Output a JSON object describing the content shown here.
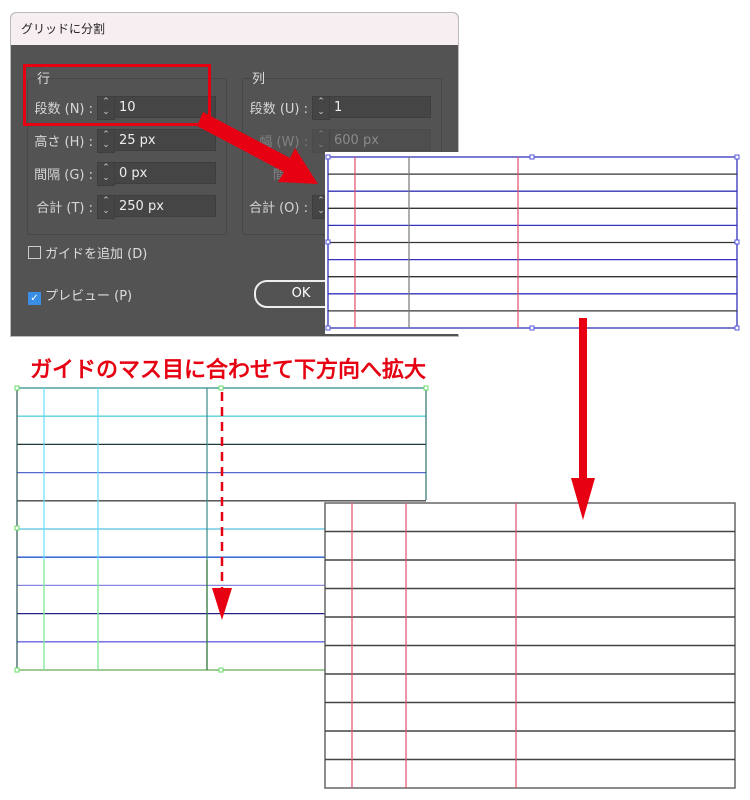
{
  "dialog": {
    "title": "グリッドに分割",
    "rows": {
      "label": "行",
      "fields": [
        {
          "label": "段数 (N) :",
          "value": "10"
        },
        {
          "label": "高さ (H) :",
          "value": "25 px"
        },
        {
          "label": "間隔 (G) :",
          "value": "0 px"
        },
        {
          "label": "合計 (T) :",
          "value": "250 px"
        }
      ]
    },
    "cols": {
      "label": "列",
      "fields": [
        {
          "label": "段数 (U) :",
          "value": "1"
        },
        {
          "label": "幅 (W) :",
          "value": "600 px"
        },
        {
          "label": "間隔 (",
          "value": ""
        },
        {
          "label": "合計 (O) :",
          "value": ""
        }
      ]
    },
    "add_guides": "ガイドを追加 (D)",
    "preview": "プレビュー (P)",
    "ok": "OK"
  },
  "caption": "ガイドのマス目に合わせて下方向へ拡大",
  "colors": {
    "accent": "#e60012",
    "guide_blue": "#3333bb",
    "red_line": "#e0506a"
  }
}
